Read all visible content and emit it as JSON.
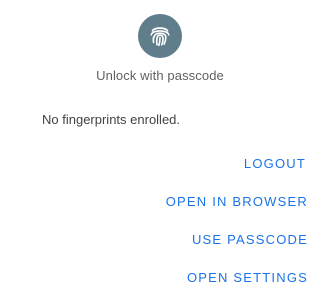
{
  "dialog": {
    "icon": "fingerprint-icon",
    "title": "Unlock with passcode",
    "message": "No fingerprints enrolled.",
    "accent_color": "#1a73e8",
    "icon_bg_color": "#607d8b"
  },
  "actions": [
    {
      "label": "LOGOUT"
    },
    {
      "label": "OPEN IN BROWSER"
    },
    {
      "label": "USE PASSCODE"
    },
    {
      "label": "OPEN SETTINGS"
    }
  ]
}
